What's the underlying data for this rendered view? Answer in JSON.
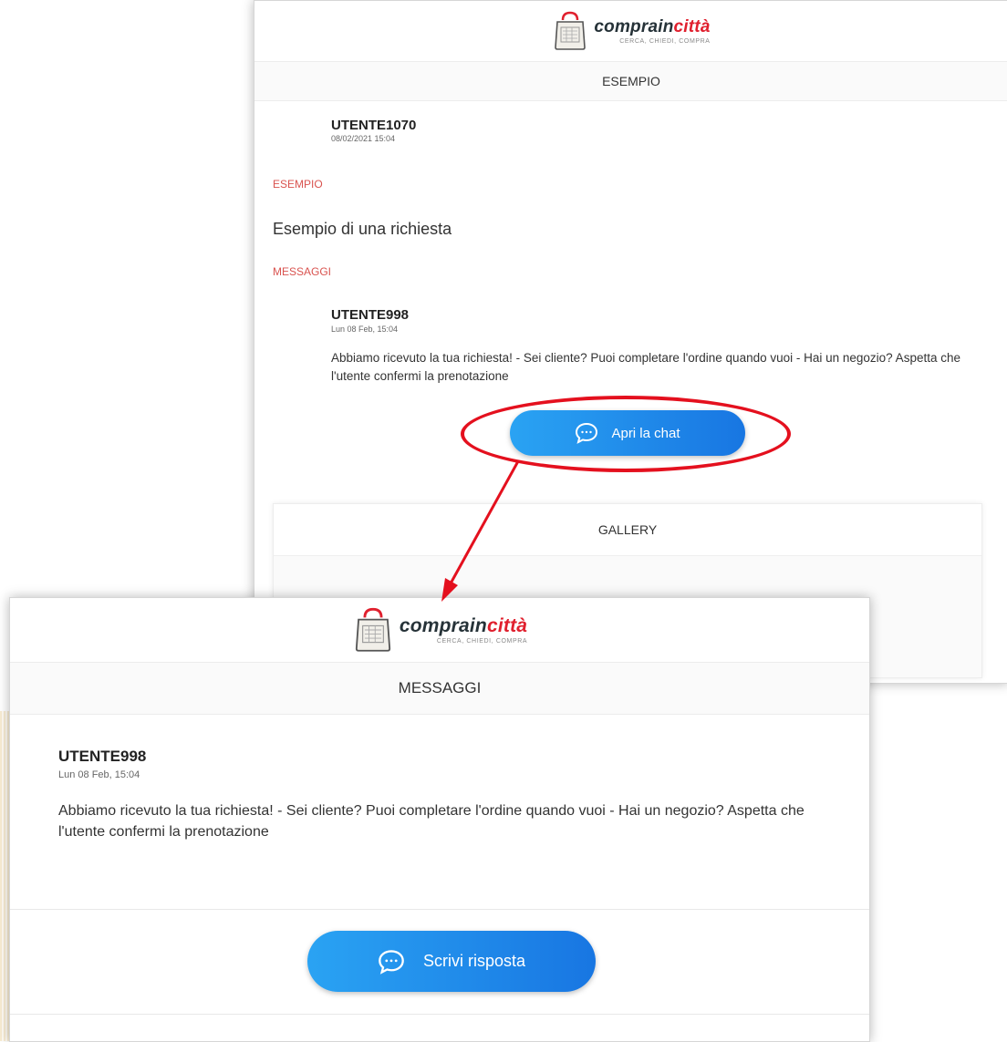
{
  "brand": {
    "name_part1": "comprain",
    "name_part2": "città",
    "tagline": "CERCA, CHIEDI, COMPRA",
    "color_dark": "#263238",
    "color_red": "#e0202e"
  },
  "request_screen": {
    "section_title": "ESEMPIO",
    "author": {
      "name": "UTENTE1070",
      "date": "08/02/2021 15:04"
    },
    "category_label": "ESEMPIO",
    "request_text": "Esempio di una richiesta",
    "messages_label": "MESSAGGI",
    "message": {
      "author": "UTENTE998",
      "date": "Lun 08 Feb, 15:04",
      "text": "Abbiamo ricevuto la tua richiesta! - Sei cliente? Puoi completare l'ordine quando vuoi - Hai un negozio? Aspetta che l'utente confermi la prenotazione"
    },
    "open_chat_label": "Apri la chat",
    "gallery_title": "GALLERY"
  },
  "messages_screen": {
    "section_title": "MESSAGGI",
    "message": {
      "author": "UTENTE998",
      "date": "Lun 08 Feb, 15:04",
      "text": "Abbiamo ricevuto la tua richiesta! - Sei cliente? Puoi completare l'ordine quando vuoi - Hai un negozio? Aspetta che l'utente confermi la prenotazione"
    },
    "reply_label": "Scrivi risposta"
  },
  "icons": {
    "logo": "shopping-bag-icon",
    "chat": "chat-bubble-icon"
  },
  "colors": {
    "button_gradient_start": "#2aa3f3",
    "button_gradient_end": "#1876e2",
    "accent_red": "#d9534f",
    "annotation_red": "#e4101e"
  }
}
